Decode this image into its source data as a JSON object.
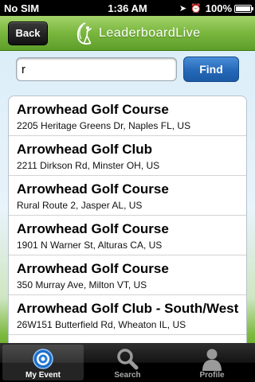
{
  "status_bar": {
    "carrier": "No SIM",
    "time": "1:36 AM",
    "battery": "100%"
  },
  "nav_bar": {
    "back_label": "Back",
    "brand_name": "LeaderboardLive"
  },
  "search": {
    "value": "r",
    "button_label": "Find"
  },
  "results": [
    {
      "name": "Arrowhead Golf Course",
      "address": "2205 Heritage Greens Dr, Naples FL, US"
    },
    {
      "name": "Arrowhead Golf Club",
      "address": "2211 Dirkson Rd, Minster OH, US"
    },
    {
      "name": "Arrowhead Golf Course",
      "address": "Rural Route 2, Jasper AL, US"
    },
    {
      "name": "Arrowhead Golf Course",
      "address": "1901 N Warner St, Alturas CA, US"
    },
    {
      "name": "Arrowhead Golf Course",
      "address": "350 Murray Ave, Milton VT, US"
    },
    {
      "name": "Arrowhead Golf Club - South/West",
      "address": "26W151 Butterfield Rd, Wheaton IL, US"
    }
  ],
  "tab_bar": {
    "tabs": [
      {
        "label": "My Event",
        "icon": "target-icon",
        "active": true
      },
      {
        "label": "Search",
        "icon": "magnifier-icon",
        "active": false
      },
      {
        "label": "Profile",
        "icon": "person-icon",
        "active": false
      }
    ]
  },
  "colors": {
    "nav_green": "#79b63e",
    "find_blue": "#2468b8",
    "tab_active_blue": "#4a90d9"
  }
}
